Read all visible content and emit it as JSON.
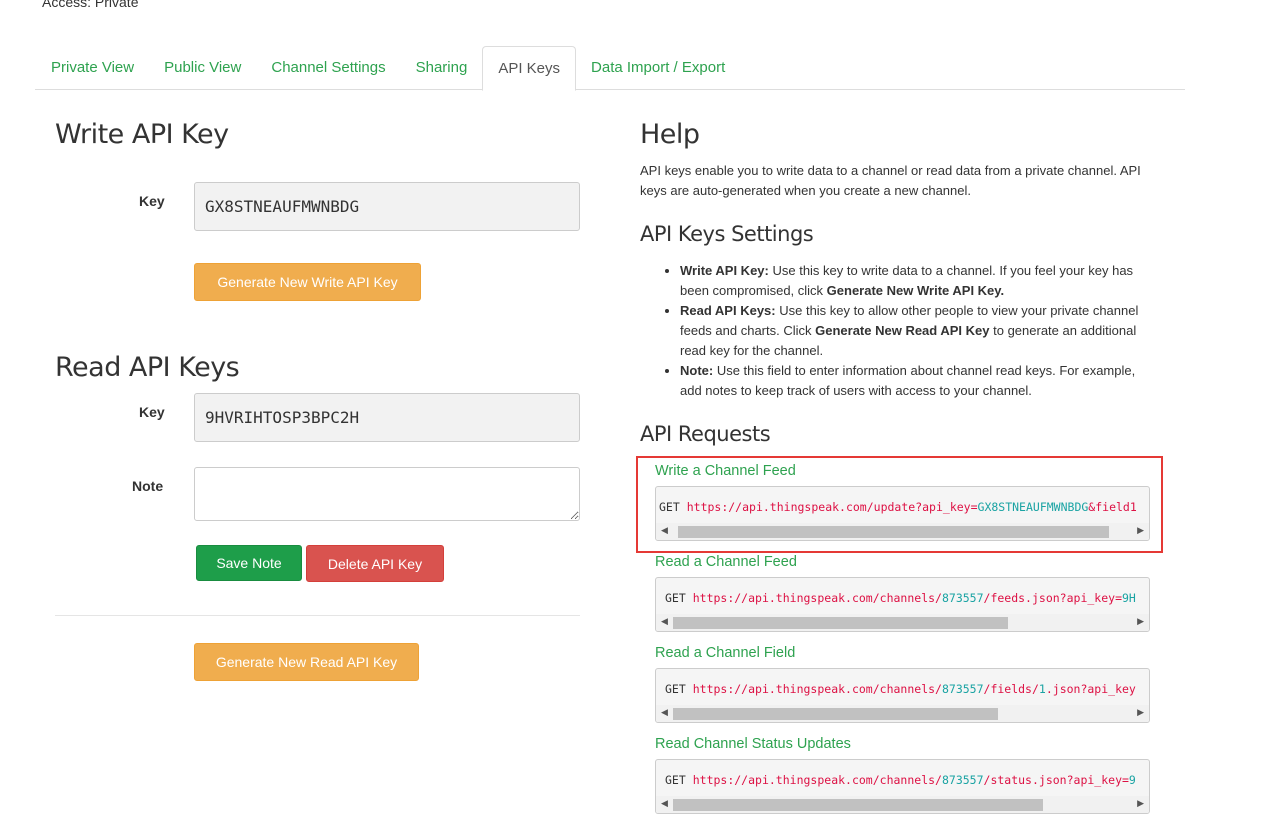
{
  "access": "Access: Private",
  "tabs": [
    {
      "label": "Private View"
    },
    {
      "label": "Public View"
    },
    {
      "label": "Channel Settings"
    },
    {
      "label": "Sharing"
    },
    {
      "label": "API Keys",
      "active": true
    },
    {
      "label": "Data Import / Export"
    }
  ],
  "write": {
    "title": "Write API Key",
    "key_label": "Key",
    "key_value": "GX8STNEAUFMWNBDG",
    "generate_label": "Generate New Write API Key"
  },
  "read": {
    "title": "Read API Keys",
    "key_label": "Key",
    "key_value": "9HVRIHTOSP3BPC2H",
    "note_label": "Note",
    "note_value": "",
    "save_label": "Save Note",
    "delete_label": "Delete API Key",
    "generate_label": "Generate New Read API Key"
  },
  "help": {
    "title": "Help",
    "intro": "API keys enable you to write data to a channel or read data from a private channel. API keys are auto-generated when you create a new channel.",
    "settings_title": "API Keys Settings",
    "items": [
      {
        "term": "Write API Key:",
        "text": " Use this key to write data to a channel. If you feel your key has been compromised, click ",
        "bold": "Generate New Write API Key.",
        "after": ""
      },
      {
        "term": "Read API Keys:",
        "text": " Use this key to allow other people to view your private channel feeds and charts. Click ",
        "bold": "Generate New Read API Key",
        "after": " to generate an additional read key for the channel."
      },
      {
        "term": "Note:",
        "text": " Use this field to enter information about channel read keys. For example, add notes to keep track of users with access to your channel.",
        "bold": "",
        "after": ""
      }
    ],
    "requests_title": "API Requests",
    "requests": [
      {
        "title": "Write a Channel Feed",
        "method": "GET",
        "parts": [
          [
            "u",
            "https://api.thingspeak.com/update?api_key="
          ],
          [
            "k",
            "GX8STNEAUFMWNBDG"
          ],
          [
            "u",
            "&field1"
          ]
        ]
      },
      {
        "title": "Read a Channel Feed",
        "method": "GET",
        "parts": [
          [
            "u",
            "https://api.thingspeak.com/channels/"
          ],
          [
            "k",
            "873557"
          ],
          [
            "u",
            "/feeds.json?api_key="
          ],
          [
            "k",
            "9H"
          ]
        ]
      },
      {
        "title": "Read a Channel Field",
        "method": "GET",
        "parts": [
          [
            "u",
            "https://api.thingspeak.com/channels/"
          ],
          [
            "k",
            "873557"
          ],
          [
            "u",
            "/fields/"
          ],
          [
            "k",
            "1"
          ],
          [
            "u",
            ".json?api_key"
          ]
        ]
      },
      {
        "title": "Read Channel Status Updates",
        "method": "GET",
        "parts": [
          [
            "u",
            "https://api.thingspeak.com/channels/"
          ],
          [
            "k",
            "873557"
          ],
          [
            "u",
            "/status.json?api_key="
          ],
          [
            "k",
            "9"
          ]
        ]
      }
    ]
  },
  "colors": {
    "link": "#2ea24f",
    "highlight": "#e53935",
    "orange": "#f0ad4e",
    "green": "#1e9e4a",
    "red": "#d9534f"
  }
}
